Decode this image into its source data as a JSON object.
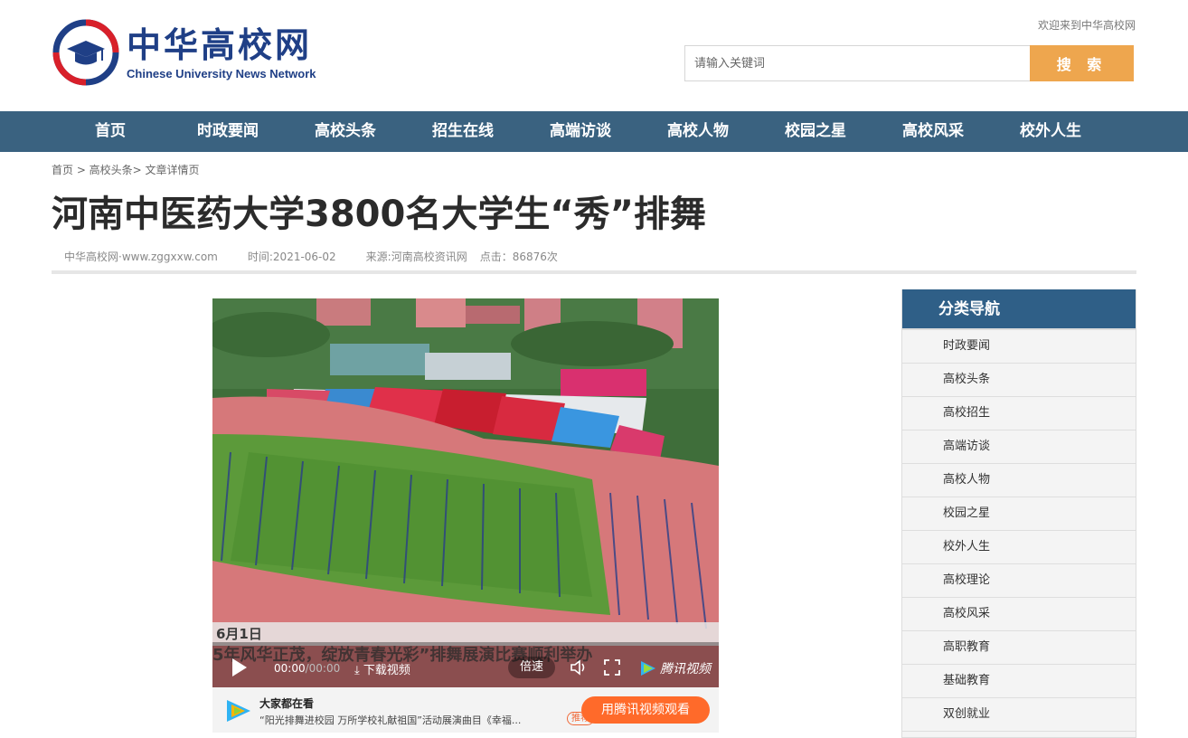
{
  "header": {
    "logo_cn": "中华高校网",
    "logo_en": "Chinese University News Network",
    "welcome": "欢迎来到中华高校网",
    "search_placeholder": "请输入关键词",
    "search_button": "搜 索"
  },
  "nav": {
    "items": [
      "首页",
      "时政要闻",
      "高校头条",
      "招生在线",
      "高端访谈",
      "高校人物",
      "校园之星",
      "高校风采",
      "校外人生"
    ]
  },
  "breadcrumb": "首页 > 高校头条> 文章详情页",
  "article": {
    "title": "河南中医药大学3800名大学生“秀”排舞",
    "site": "中华高校网·www.zggxxw.com",
    "time": "时间:2021-06-02",
    "source": "来源:河南高校资讯网",
    "clicks": "点击：86876次"
  },
  "video": {
    "time_current": "00:00",
    "time_total": "/00:00",
    "download": "下载视频",
    "speed": "倍速",
    "brand": "腾讯视频",
    "subtitle": "5年风华正茂，绽放青春光彩”排舞展演比赛顺利举办"
  },
  "watching": {
    "title": "大家都在看",
    "desc": "“阳光排舞进校园 万所学校礼献祖国”活动展演曲目《幸福...",
    "tag": "推荐",
    "button": "用腾讯视频观看"
  },
  "sidebar": {
    "title": "分类导航",
    "items": [
      "时政要闻",
      "高校头条",
      "高校招生",
      "高端访谈",
      "高校人物",
      "校园之星",
      "校外人生",
      "高校理论",
      "高校风采",
      "高职教育",
      "基础教育",
      "双创就业"
    ]
  },
  "colors": {
    "nav_bg": "#3a6280",
    "search_button": "#eea64e",
    "sidebar_head": "#2f5f87",
    "logo_blue": "#1f3f86",
    "logo_red": "#d8202a"
  }
}
